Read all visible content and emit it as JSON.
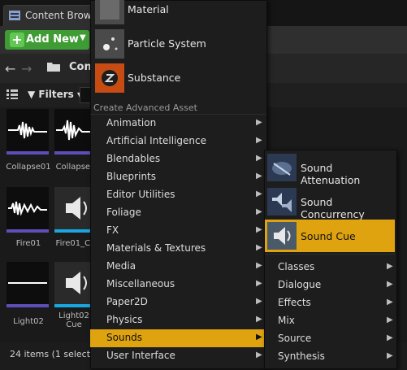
{
  "tab": {
    "title": "Content Brows"
  },
  "toolbar": {
    "add_new": "Add New"
  },
  "nav": {
    "path": "Con"
  },
  "filters": {
    "label": "Filters"
  },
  "assets": [
    {
      "name": "Collapse01"
    },
    {
      "name": "Collapse0"
    },
    {
      "name": "Fire01"
    },
    {
      "name": "Fire01_Cu"
    },
    {
      "name": "Light02"
    },
    {
      "name": "Light02 Cue"
    }
  ],
  "status": {
    "text": "24 items (1 selecte"
  },
  "menu": {
    "top_items": [
      {
        "label": "Material"
      },
      {
        "label": "Particle System"
      },
      {
        "label": "Substance"
      }
    ],
    "section_title": "Create Advanced Asset",
    "items": [
      {
        "label": "Animation"
      },
      {
        "label": "Artificial Intelligence"
      },
      {
        "label": "Blendables"
      },
      {
        "label": "Blueprints"
      },
      {
        "label": "Editor Utilities"
      },
      {
        "label": "Foliage"
      },
      {
        "label": "FX"
      },
      {
        "label": "Materials & Textures"
      },
      {
        "label": "Media"
      },
      {
        "label": "Miscellaneous"
      },
      {
        "label": "Paper2D"
      },
      {
        "label": "Physics"
      },
      {
        "label": "Sounds"
      },
      {
        "label": "User Interface"
      }
    ],
    "selected": "Sounds"
  },
  "submenu": {
    "icon_items": [
      {
        "label": "Sound Attenuation"
      },
      {
        "label": "Sound Concurrency"
      },
      {
        "label": "Sound Cue"
      }
    ],
    "selected": "Sound Cue",
    "items": [
      {
        "label": "Classes"
      },
      {
        "label": "Dialogue"
      },
      {
        "label": "Effects"
      },
      {
        "label": "Mix"
      },
      {
        "label": "Source"
      },
      {
        "label": "Synthesis"
      }
    ]
  },
  "colors": {
    "highlight": "#dfa310",
    "add_new": "#3f9c35",
    "sound_wave_bar": "#5e4fb8",
    "sound_cue_bar": "#19a7e0"
  }
}
